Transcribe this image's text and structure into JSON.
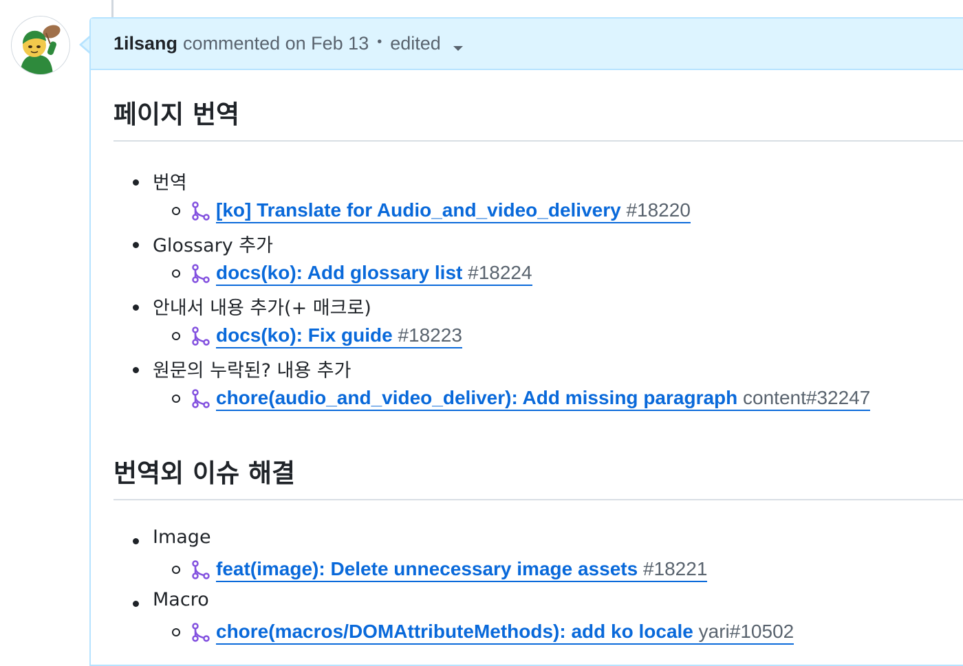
{
  "comment": {
    "author": "1ilsang",
    "action": "commented on Feb 13",
    "separator": "•",
    "edited": "edited"
  },
  "sections": [
    {
      "heading": "페이지 번역",
      "items": [
        {
          "label": "번역",
          "pr_title": "[ko] Translate for Audio_and_video_delivery",
          "pr_ref": "#18220"
        },
        {
          "label": "Glossary 추가",
          "pr_title": "docs(ko): Add glossary list",
          "pr_ref": "#18224"
        },
        {
          "label": "안내서 내용 추가(+ 매크로)",
          "pr_title": "docs(ko): Fix guide",
          "pr_ref": "#18223"
        },
        {
          "label": "원문의 누락된? 내용 추가",
          "pr_title": "chore(audio_and_video_deliver): Add missing paragraph",
          "pr_ref": "content#32247"
        }
      ]
    },
    {
      "heading": "번역외 이슈 해결",
      "items": [
        {
          "label": "Image",
          "pr_title": "feat(image): Delete unnecessary image assets",
          "pr_ref": "#18221"
        },
        {
          "label": "Macro",
          "pr_title": "chore(macros/DOMAttributeMethods): add ko locale",
          "pr_ref": "yari#10502"
        }
      ]
    }
  ],
  "icons": {
    "avatar": "avatar-icon",
    "pull_request": "git-pull-request-icon",
    "caret": "caret-down-icon"
  },
  "colors": {
    "link": "#0969da",
    "pr_icon": "#8250df",
    "header_bg": "#ddf4ff",
    "header_border": "#b6e3ff",
    "muted": "#59636e"
  }
}
